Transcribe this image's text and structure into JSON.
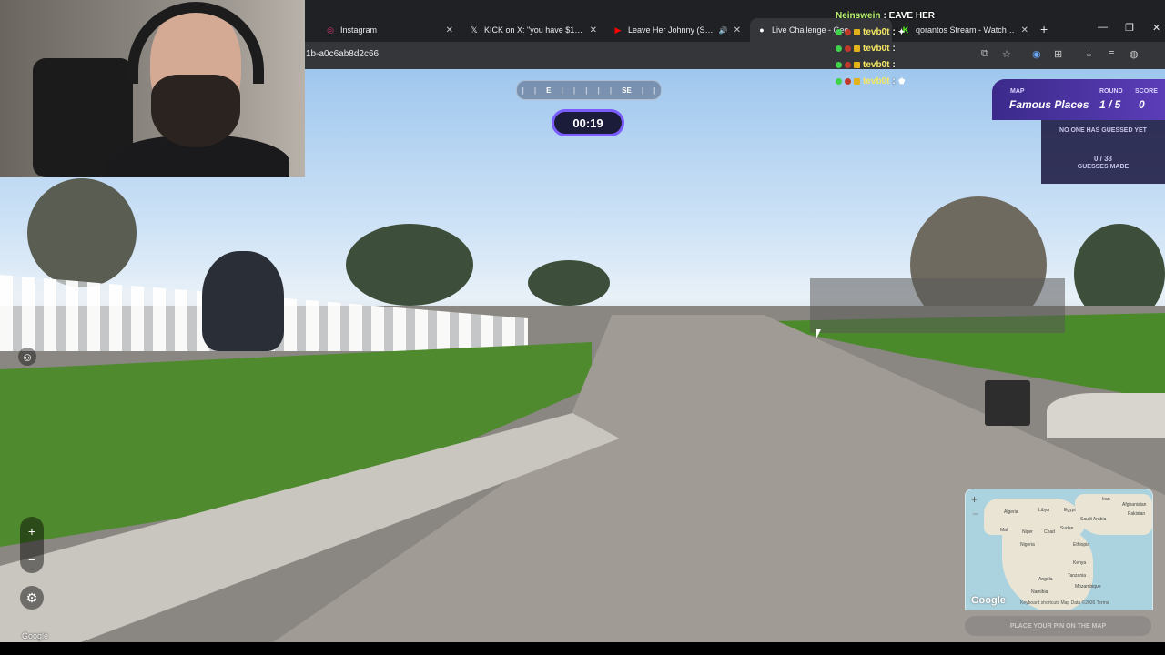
{
  "browser": {
    "tabs": [
      {
        "icon": "instagram-icon",
        "title": "Instagram"
      },
      {
        "icon": "x-icon",
        "title": "KICK on X: \"you have $100 to b"
      },
      {
        "icon": "youtube-icon",
        "title": "Leave Her Johnny (Sea Sha"
      },
      {
        "icon": "geoguessr-icon",
        "title": "Live Challenge - Geo"
      },
      {
        "icon": "kick-icon",
        "title": "qorantos Stream - Watch Live o"
      }
    ],
    "url": "1b-a0c6ab8d2c66"
  },
  "chat": [
    {
      "user": "Neinswein",
      "message": ": EAVE HER",
      "user_color": "#b7f36b"
    },
    {
      "user": "tevb0t",
      "message": ":",
      "user_color": "#f5e663"
    },
    {
      "user": "tevb0t",
      "message": ":",
      "user_color": "#f5e663"
    },
    {
      "user": "tevb0t",
      "message": ":",
      "user_color": "#f5e663"
    },
    {
      "user": "tevb0t",
      "message": ":",
      "user_color": "#f5e663"
    }
  ],
  "game": {
    "compass": {
      "e": "E",
      "se": "SE"
    },
    "timer": "00:19",
    "map_label": "MAP",
    "map_name": "Famous Places",
    "round_label": "ROUND",
    "round_value": "1 / 5",
    "score_label": "SCORE",
    "score_value": "0",
    "guess_status": "NO ONE HAS GUESSED YET",
    "guesses_count": "0 / 33",
    "guesses_label": "GUESSES MADE",
    "place_pin": "PLACE YOUR PIN ON THE MAP",
    "streetview_brand": "Google"
  },
  "minimap": {
    "labels": [
      "Algeria",
      "Libya",
      "Egypt",
      "Mali",
      "Niger",
      "Chad",
      "Sudan",
      "Nigeria",
      "Ethiopia",
      "Kenya",
      "Tanzania",
      "Angola",
      "Namibia",
      "Iran",
      "Afghanistan",
      "Pakistan",
      "Saudi Arabia",
      "Mozambique"
    ],
    "brand": "Google",
    "footer": "Keyboard shortcuts   Map Data ©2026   Terms"
  },
  "colors": {
    "accent": "#7b5cff",
    "panel": "#3b2a8a",
    "grass": "#4f8a2e"
  }
}
